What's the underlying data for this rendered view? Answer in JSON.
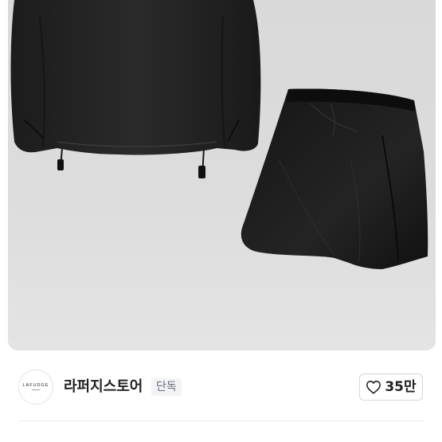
{
  "product_image": {
    "alt_icon": "product-photo"
  },
  "store": {
    "logo_text": "LAFUDGE",
    "name": "라퍼지스토어",
    "badge": "단독"
  },
  "like": {
    "icon": "heart-outline-icon",
    "count": "35만"
  }
}
